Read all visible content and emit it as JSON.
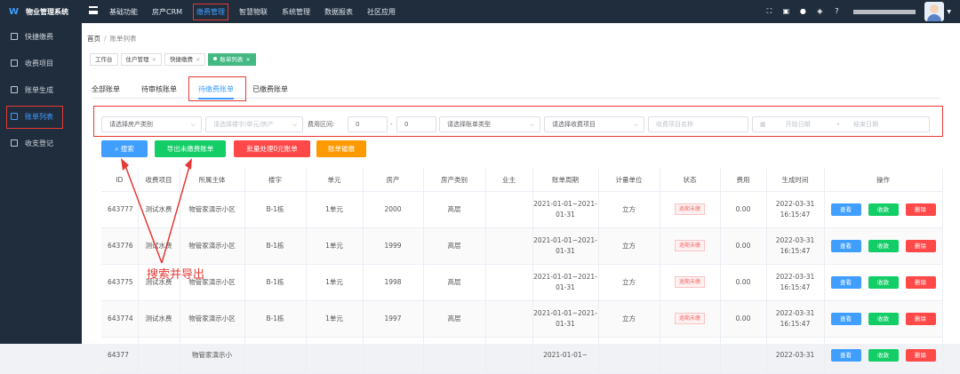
{
  "app": {
    "title": "物业管理系统",
    "logo_mark": "W"
  },
  "topnav": [
    "基础功能",
    "房产CRM",
    "缴费管理",
    "智慧物联",
    "系统管理",
    "数据报表",
    "社区应用"
  ],
  "topnav_active": "缴费管理",
  "top_icons": [
    "fullscreen-icon",
    "screen-icon",
    "bell-icon",
    "layers-icon",
    "help-icon"
  ],
  "sidebar": [
    {
      "label": "快捷缴费",
      "icon": "quick-pay-icon"
    },
    {
      "label": "收费项目",
      "icon": "charge-item-icon"
    },
    {
      "label": "账单生成",
      "icon": "bill-generate-icon"
    },
    {
      "label": "账单列表",
      "icon": "bill-list-icon",
      "active": true
    },
    {
      "label": "收支登记",
      "icon": "ledger-icon"
    }
  ],
  "breadcrumb": {
    "home": "首页",
    "sep": "/",
    "current": "账单列表"
  },
  "tags": [
    "工作台",
    "住户管理",
    "快捷缴费",
    "账单列表"
  ],
  "tabs": [
    "全部账单",
    "待审核账单",
    "待缴费账单",
    "已缴费账单"
  ],
  "active_tab": "待缴费账单",
  "filters": {
    "house_type": "请选择房产类别",
    "building": "请选择楼宇/单元/房产",
    "fee_range_label": "费用区间:",
    "fee_min": "0",
    "fee_sep": "-",
    "fee_max": "0",
    "bill_type": "请选择账单类型",
    "charge_item": "请选择收费项目",
    "item_name": "收费项目名称",
    "start_date": "开始日期",
    "date_sep": "-",
    "end_date": "结束日期"
  },
  "actions": {
    "search": "搜索",
    "export": "导出未缴费账单",
    "batch": "批量处理0元账单",
    "remind": "账单催缴"
  },
  "table": {
    "headers": [
      "ID",
      "收费项目",
      "所属主体",
      "楼宇",
      "单元",
      "房产",
      "房产类别",
      "业主",
      "账单周期",
      "计量单位",
      "状态",
      "费用",
      "生成时间",
      "操作"
    ],
    "rows": [
      {
        "id": "643777",
        "item": "测试水费",
        "owner_entity": "物管家演示小区",
        "building": "B-1栋",
        "unit": "1单元",
        "house": "2000",
        "type": "高层",
        "owner": "",
        "period": "2021-01-01~2021-01-31",
        "uom": "立方",
        "status": "逾期未缴",
        "fee": "0.00",
        "created": "2022-03-31 16:15:47"
      },
      {
        "id": "643776",
        "item": "测试水费",
        "owner_entity": "物管家演示小区",
        "building": "B-1栋",
        "unit": "1单元",
        "house": "1999",
        "type": "高层",
        "owner": "",
        "period": "2021-01-01~2021-01-31",
        "uom": "立方",
        "status": "逾期未缴",
        "fee": "0.00",
        "created": "2022-03-31 16:15:47"
      },
      {
        "id": "643775",
        "item": "测试水费",
        "owner_entity": "物管家演示小区",
        "building": "B-1栋",
        "unit": "1单元",
        "house": "1998",
        "type": "高层",
        "owner": "",
        "period": "2021-01-01~2021-01-31",
        "uom": "立方",
        "status": "逾期未缴",
        "fee": "0.00",
        "created": "2022-03-31 16:15:47"
      },
      {
        "id": "643774",
        "item": "测试水费",
        "owner_entity": "物管家演示小区",
        "building": "B-1栋",
        "unit": "1单元",
        "house": "1997",
        "type": "高层",
        "owner": "",
        "period": "2021-01-01~2021-01-31",
        "uom": "立方",
        "status": "逾期未缴",
        "fee": "0.00",
        "created": "2022-03-31 16:15:47"
      },
      {
        "id": "64377",
        "item": "",
        "owner_entity": "物管家演示小",
        "building": "",
        "unit": "",
        "house": "",
        "type": "",
        "owner": "",
        "period": "2021-01-01~",
        "uom": "",
        "status": "",
        "fee": "",
        "created": "2022-03-31"
      }
    ],
    "row_actions": [
      "查看",
      "收款",
      "删除"
    ]
  },
  "annotation": "搜索并导出",
  "colors": {
    "sidebar_bg": "#1f2d3d",
    "primary": "#409eff",
    "success": "#13ce66",
    "danger": "#ff4949",
    "warning": "#ff9900",
    "highlight": "#e53935"
  }
}
